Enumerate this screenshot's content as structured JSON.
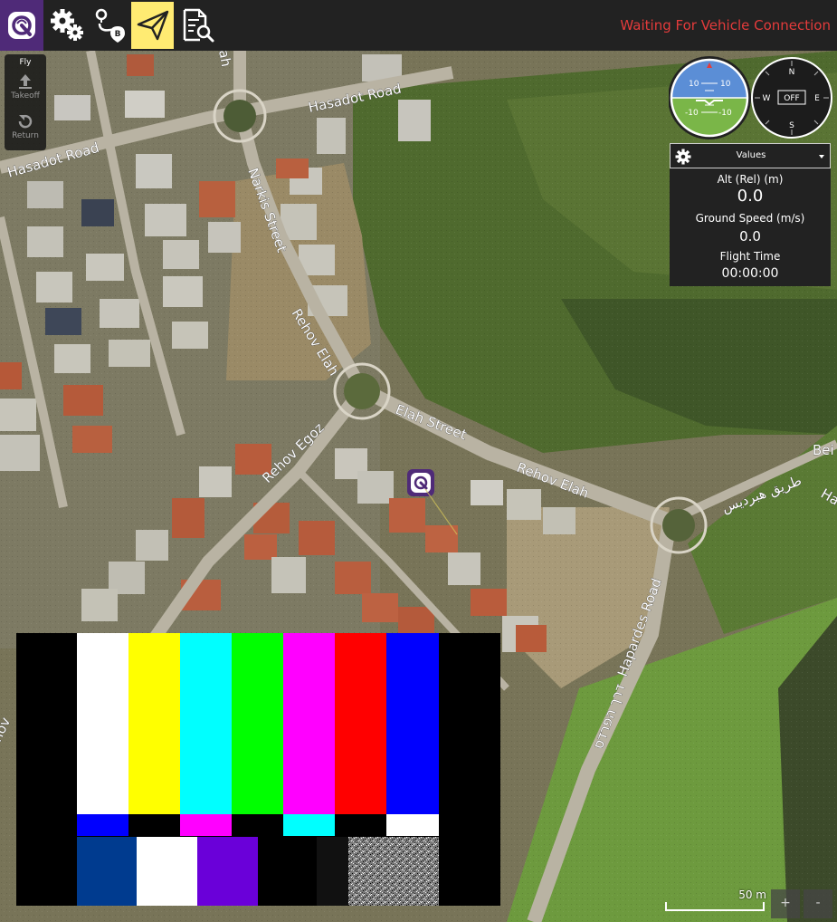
{
  "toolbar": {
    "status_text": "Waiting For Vehicle Connection"
  },
  "fly_tools": {
    "title": "Fly",
    "items": [
      {
        "label": "Takeoff",
        "icon": "takeoff-icon"
      },
      {
        "label": "Return",
        "icon": "return-icon"
      }
    ]
  },
  "instrument": {
    "pitch_marks": [
      "10",
      "10",
      "-10",
      "-10"
    ],
    "compass": {
      "north": "N",
      "east": "E",
      "south": "S",
      "west": "W",
      "heading_text": "OFF"
    }
  },
  "values_panel": {
    "title": "Values",
    "rows": [
      {
        "label": "Alt (Rel) (m)",
        "value": "0.0"
      },
      {
        "label": "Ground Speed (m/s)",
        "value": "0.0"
      },
      {
        "label": "Flight Time",
        "value": "00:00:00"
      }
    ]
  },
  "map": {
    "labels": [
      "Hasadot Road",
      "Hasadot Road",
      "Narkis Street",
      "Rehov Elah",
      "Elah Street",
      "Rehov Elah",
      "Rehov Egoz",
      "Hapardes Road",
      "דרך הפרדס",
      "طريق هبرديس",
      "Bei",
      "Ha",
      "ah",
      "hov"
    ]
  },
  "scale": {
    "label": "50 m"
  },
  "zoom": {
    "in": "+",
    "out": "-"
  },
  "colors": {
    "toolbar_bg": "#222222",
    "logo_bg": "#4f2a78",
    "fly_active": "#ffeb72",
    "status": "#e33b3b",
    "sky": "#5b8ed6",
    "ground": "#7ab648"
  }
}
